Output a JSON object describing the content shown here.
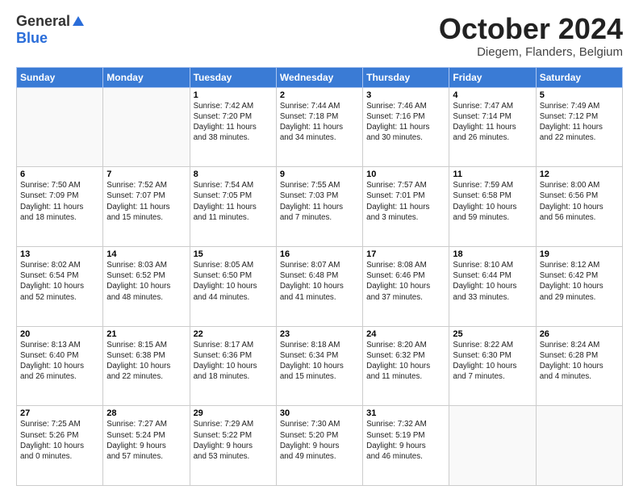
{
  "header": {
    "logo_general": "General",
    "logo_blue": "Blue",
    "month_title": "October 2024",
    "location": "Diegem, Flanders, Belgium"
  },
  "days_of_week": [
    "Sunday",
    "Monday",
    "Tuesday",
    "Wednesday",
    "Thursday",
    "Friday",
    "Saturday"
  ],
  "weeks": [
    [
      {
        "day": "",
        "info": ""
      },
      {
        "day": "",
        "info": ""
      },
      {
        "day": "1",
        "info": "Sunrise: 7:42 AM\nSunset: 7:20 PM\nDaylight: 11 hours\nand 38 minutes."
      },
      {
        "day": "2",
        "info": "Sunrise: 7:44 AM\nSunset: 7:18 PM\nDaylight: 11 hours\nand 34 minutes."
      },
      {
        "day": "3",
        "info": "Sunrise: 7:46 AM\nSunset: 7:16 PM\nDaylight: 11 hours\nand 30 minutes."
      },
      {
        "day": "4",
        "info": "Sunrise: 7:47 AM\nSunset: 7:14 PM\nDaylight: 11 hours\nand 26 minutes."
      },
      {
        "day": "5",
        "info": "Sunrise: 7:49 AM\nSunset: 7:12 PM\nDaylight: 11 hours\nand 22 minutes."
      }
    ],
    [
      {
        "day": "6",
        "info": "Sunrise: 7:50 AM\nSunset: 7:09 PM\nDaylight: 11 hours\nand 18 minutes."
      },
      {
        "day": "7",
        "info": "Sunrise: 7:52 AM\nSunset: 7:07 PM\nDaylight: 11 hours\nand 15 minutes."
      },
      {
        "day": "8",
        "info": "Sunrise: 7:54 AM\nSunset: 7:05 PM\nDaylight: 11 hours\nand 11 minutes."
      },
      {
        "day": "9",
        "info": "Sunrise: 7:55 AM\nSunset: 7:03 PM\nDaylight: 11 hours\nand 7 minutes."
      },
      {
        "day": "10",
        "info": "Sunrise: 7:57 AM\nSunset: 7:01 PM\nDaylight: 11 hours\nand 3 minutes."
      },
      {
        "day": "11",
        "info": "Sunrise: 7:59 AM\nSunset: 6:58 PM\nDaylight: 10 hours\nand 59 minutes."
      },
      {
        "day": "12",
        "info": "Sunrise: 8:00 AM\nSunset: 6:56 PM\nDaylight: 10 hours\nand 56 minutes."
      }
    ],
    [
      {
        "day": "13",
        "info": "Sunrise: 8:02 AM\nSunset: 6:54 PM\nDaylight: 10 hours\nand 52 minutes."
      },
      {
        "day": "14",
        "info": "Sunrise: 8:03 AM\nSunset: 6:52 PM\nDaylight: 10 hours\nand 48 minutes."
      },
      {
        "day": "15",
        "info": "Sunrise: 8:05 AM\nSunset: 6:50 PM\nDaylight: 10 hours\nand 44 minutes."
      },
      {
        "day": "16",
        "info": "Sunrise: 8:07 AM\nSunset: 6:48 PM\nDaylight: 10 hours\nand 41 minutes."
      },
      {
        "day": "17",
        "info": "Sunrise: 8:08 AM\nSunset: 6:46 PM\nDaylight: 10 hours\nand 37 minutes."
      },
      {
        "day": "18",
        "info": "Sunrise: 8:10 AM\nSunset: 6:44 PM\nDaylight: 10 hours\nand 33 minutes."
      },
      {
        "day": "19",
        "info": "Sunrise: 8:12 AM\nSunset: 6:42 PM\nDaylight: 10 hours\nand 29 minutes."
      }
    ],
    [
      {
        "day": "20",
        "info": "Sunrise: 8:13 AM\nSunset: 6:40 PM\nDaylight: 10 hours\nand 26 minutes."
      },
      {
        "day": "21",
        "info": "Sunrise: 8:15 AM\nSunset: 6:38 PM\nDaylight: 10 hours\nand 22 minutes."
      },
      {
        "day": "22",
        "info": "Sunrise: 8:17 AM\nSunset: 6:36 PM\nDaylight: 10 hours\nand 18 minutes."
      },
      {
        "day": "23",
        "info": "Sunrise: 8:18 AM\nSunset: 6:34 PM\nDaylight: 10 hours\nand 15 minutes."
      },
      {
        "day": "24",
        "info": "Sunrise: 8:20 AM\nSunset: 6:32 PM\nDaylight: 10 hours\nand 11 minutes."
      },
      {
        "day": "25",
        "info": "Sunrise: 8:22 AM\nSunset: 6:30 PM\nDaylight: 10 hours\nand 7 minutes."
      },
      {
        "day": "26",
        "info": "Sunrise: 8:24 AM\nSunset: 6:28 PM\nDaylight: 10 hours\nand 4 minutes."
      }
    ],
    [
      {
        "day": "27",
        "info": "Sunrise: 7:25 AM\nSunset: 5:26 PM\nDaylight: 10 hours\nand 0 minutes."
      },
      {
        "day": "28",
        "info": "Sunrise: 7:27 AM\nSunset: 5:24 PM\nDaylight: 9 hours\nand 57 minutes."
      },
      {
        "day": "29",
        "info": "Sunrise: 7:29 AM\nSunset: 5:22 PM\nDaylight: 9 hours\nand 53 minutes."
      },
      {
        "day": "30",
        "info": "Sunrise: 7:30 AM\nSunset: 5:20 PM\nDaylight: 9 hours\nand 49 minutes."
      },
      {
        "day": "31",
        "info": "Sunrise: 7:32 AM\nSunset: 5:19 PM\nDaylight: 9 hours\nand 46 minutes."
      },
      {
        "day": "",
        "info": ""
      },
      {
        "day": "",
        "info": ""
      }
    ]
  ]
}
